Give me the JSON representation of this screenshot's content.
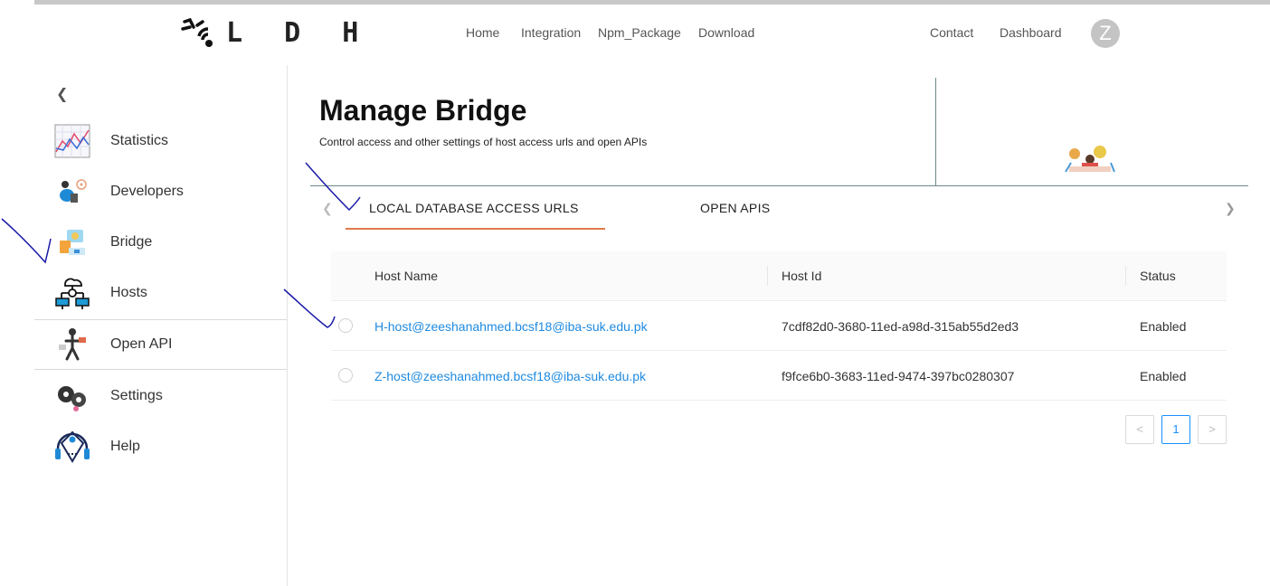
{
  "brand": {
    "logo_text": "L D H"
  },
  "nav": {
    "home": "Home",
    "integration": "Integration",
    "npm_package": "Npm_Package",
    "download": "Download",
    "contact": "Contact",
    "dashboard": "Dashboard",
    "avatar_initial": "Z"
  },
  "sidebar": {
    "collapse_icon": "chevron-left-icon",
    "items": [
      {
        "label": "Statistics",
        "icon": "statistics-chart-icon"
      },
      {
        "label": "Developers",
        "icon": "developers-icon"
      },
      {
        "label": "Bridge",
        "icon": "bridge-icon"
      },
      {
        "label": "Hosts",
        "icon": "hosts-network-icon"
      },
      {
        "label": "Open API",
        "icon": "open-api-icon"
      },
      {
        "label": "Settings",
        "icon": "settings-gears-icon"
      },
      {
        "label": "Help",
        "icon": "help-headset-icon"
      }
    ]
  },
  "page": {
    "title": "Manage Bridge",
    "subtitle": "Control access and other settings of host access urls and open APIs"
  },
  "tabs": [
    {
      "label": "LOCAL DATABASE ACCESS URLS",
      "active": true
    },
    {
      "label": "OPEN APIS",
      "active": false
    }
  ],
  "table": {
    "columns": [
      "Host Name",
      "Host Id",
      "Status"
    ],
    "rows": [
      {
        "host_name": "H-host@zeeshanahmed.bcsf18@iba-suk.edu.pk",
        "host_id": "7cdf82d0-3680-11ed-a98d-315ab55d2ed3",
        "status": "Enabled"
      },
      {
        "host_name": "Z-host@zeeshanahmed.bcsf18@iba-suk.edu.pk",
        "host_id": "f9fce6b0-3683-11ed-9474-397bc0280307",
        "status": "Enabled"
      }
    ]
  },
  "pagination": {
    "prev": "<",
    "current": "1",
    "next": ">"
  },
  "colors": {
    "link": "#1f8ae0",
    "tab_ink": "#e07a4c",
    "divider": "#6a8a86",
    "annotation": "#1a1aa8"
  }
}
